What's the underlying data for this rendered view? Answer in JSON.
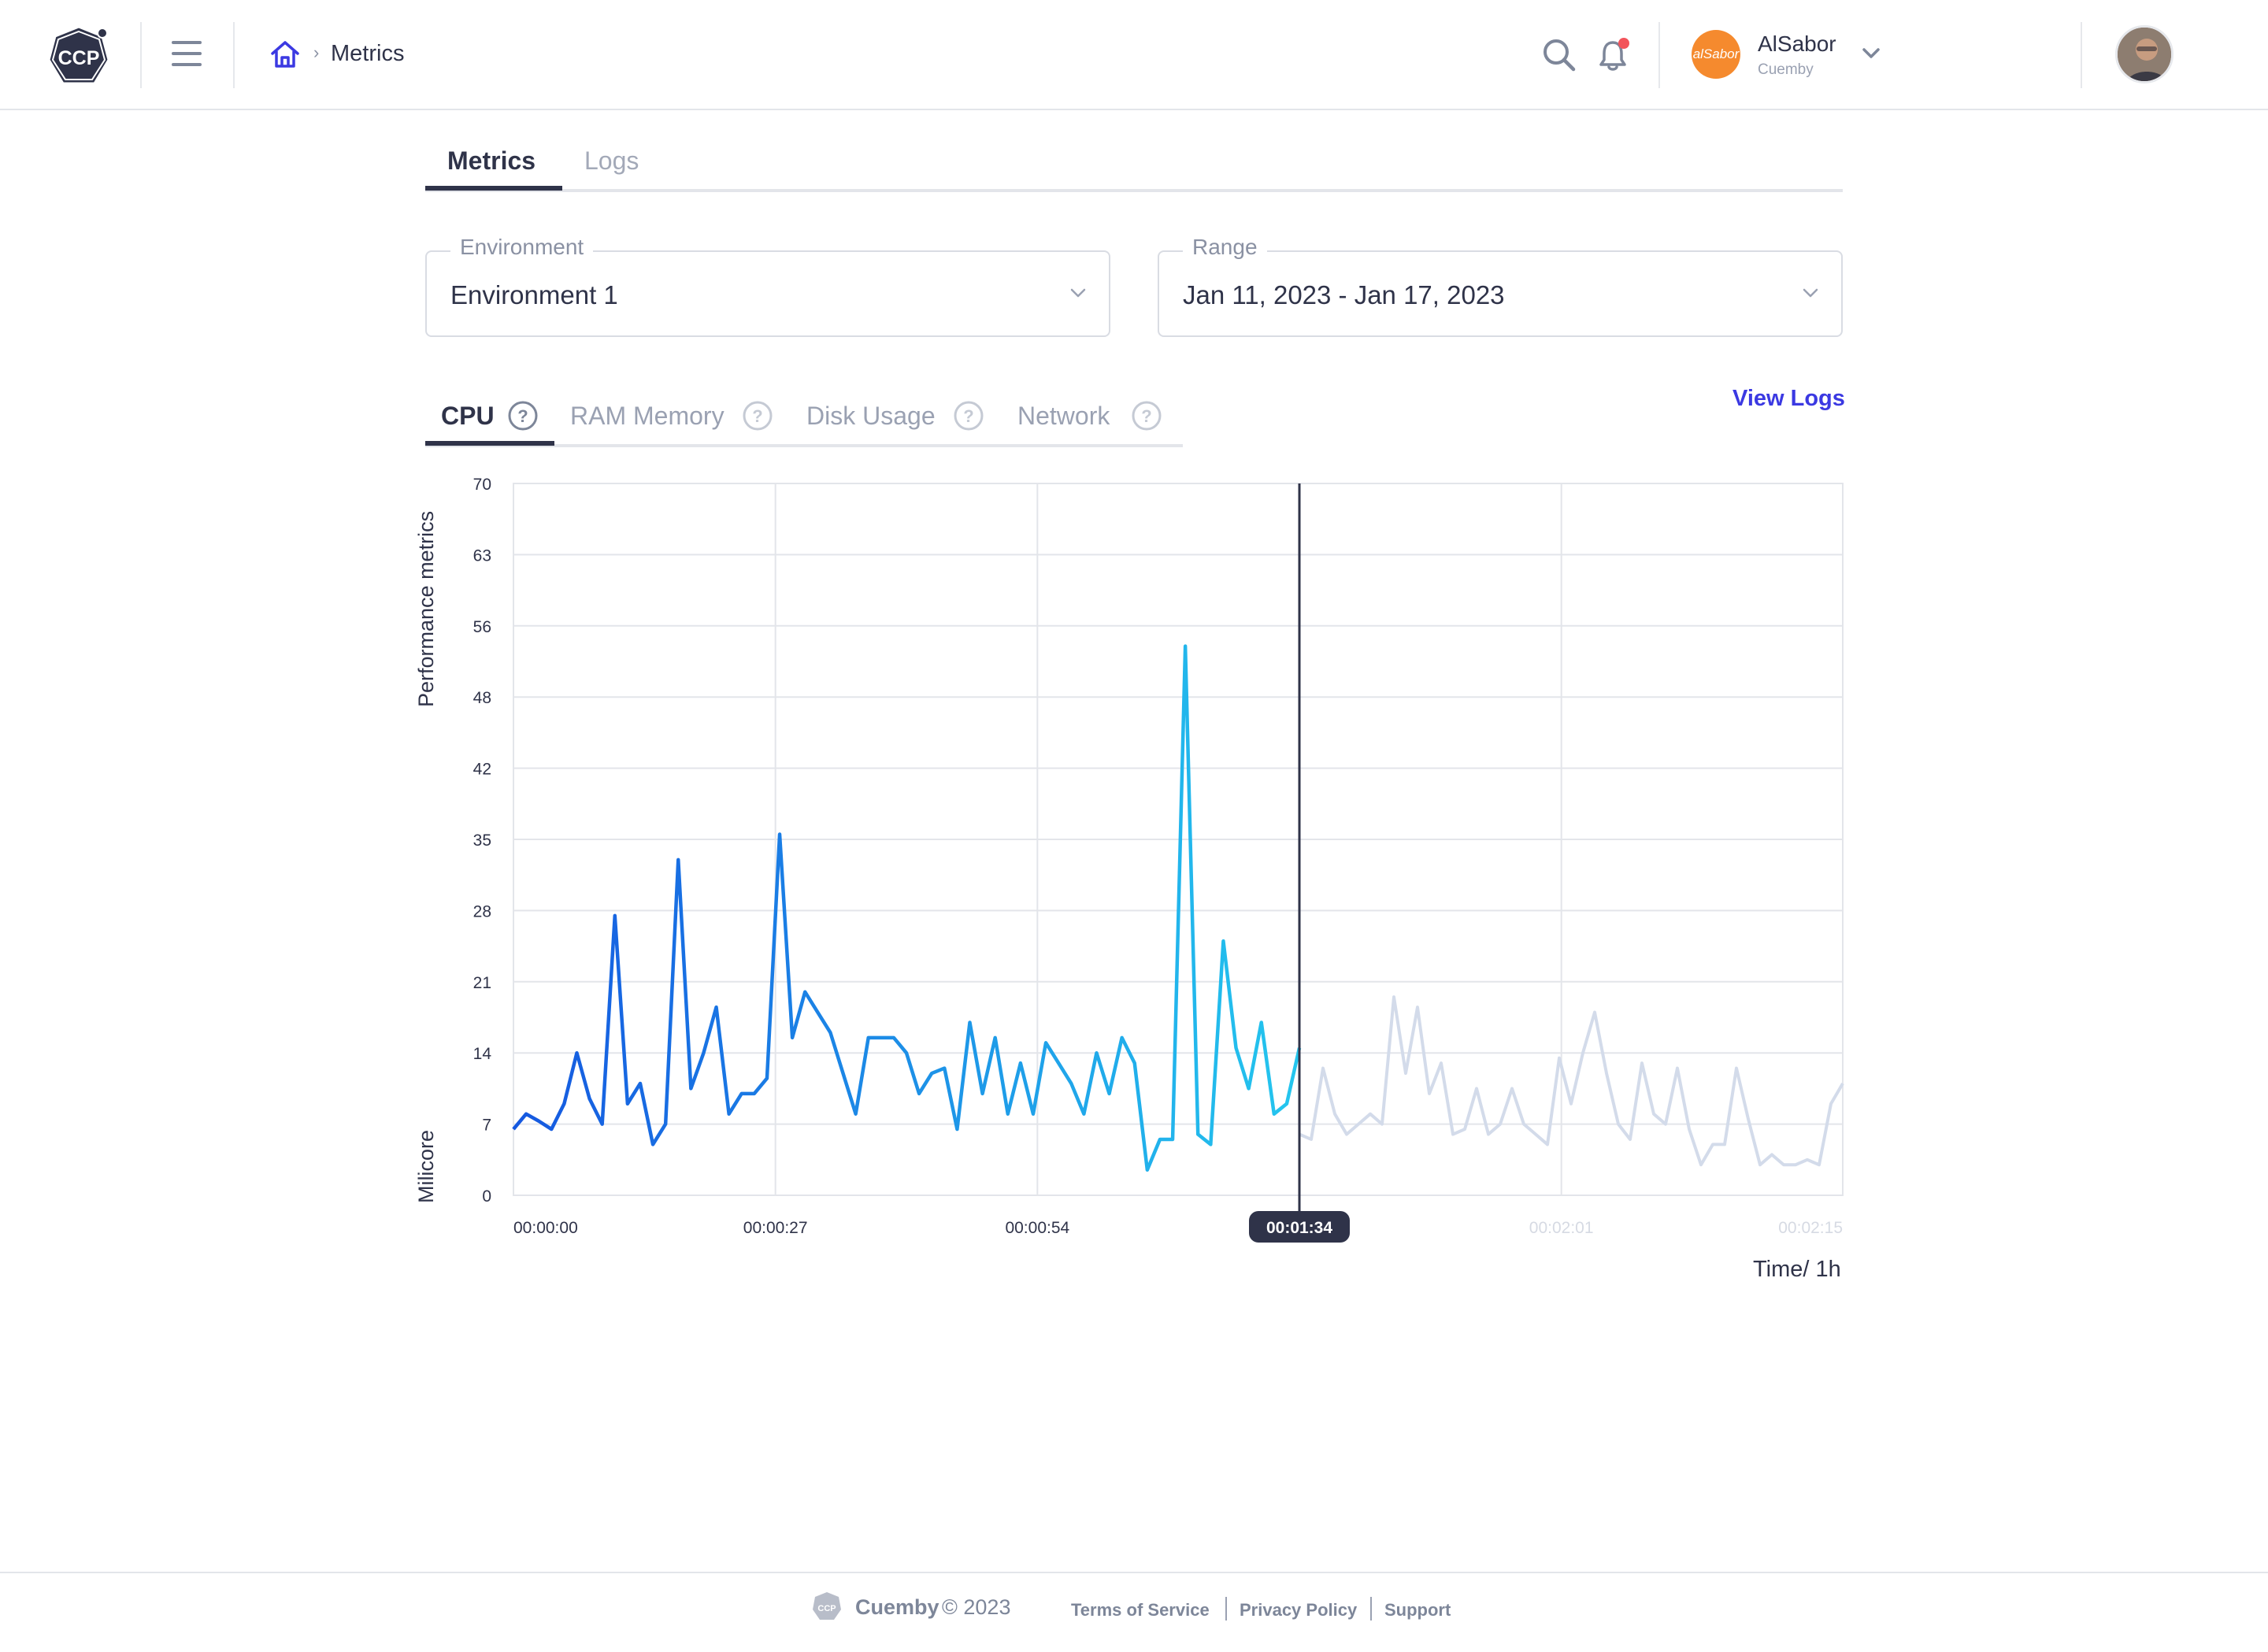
{
  "header": {
    "logo_text": "CCP",
    "breadcrumb_current": "Metrics",
    "org_name": "AlSabor",
    "org_logo_text": "alSabor",
    "org_sub": "Cuemby"
  },
  "page_tabs": [
    {
      "label": "Metrics",
      "active": true
    },
    {
      "label": "Logs",
      "active": false
    }
  ],
  "filters": {
    "environment": {
      "label": "Environment",
      "value": "Environment 1"
    },
    "range": {
      "label": "Range",
      "value": "Jan 11, 2023 - Jan 17, 2023"
    }
  },
  "metric_tabs": [
    {
      "label": "CPU",
      "active": true
    },
    {
      "label": "RAM Memory",
      "active": false
    },
    {
      "label": "Disk Usage",
      "active": false
    },
    {
      "label": "Network",
      "active": false
    }
  ],
  "view_logs_label": "View Logs",
  "colors": {
    "accent": "#3b39e2",
    "line_start": "#1558e0",
    "line_end": "#24c6ee",
    "line_future": "#d3dbea",
    "cursor": "#2f3349",
    "notify": "#f2545b"
  },
  "chart_data": {
    "type": "line",
    "ylabel_top": "Performance metrics",
    "ylabel_bottom": "Milicore",
    "xlabel": "Time/ 1h",
    "y_ticks": [
      "70",
      "63",
      "56",
      "48",
      "42",
      "35",
      "28",
      "21",
      "14",
      "7",
      "0"
    ],
    "ylim": [
      0,
      70
    ],
    "x_tick_labels": [
      "00:00:00",
      "00:00:27",
      "00:00:54",
      "00:01:34",
      "00:02:01",
      "00:02:15"
    ],
    "x_tick_positions": [
      0,
      27,
      54,
      81,
      108,
      137
    ],
    "xlim": [
      0,
      137
    ],
    "cursor_x": 81,
    "cursor_label": "00:01:34",
    "grid": true,
    "series": [
      {
        "values": [
          6.5,
          8,
          7.3,
          6.5,
          9,
          14,
          9.5,
          7,
          27.5,
          9,
          11,
          5,
          7,
          33,
          10.5,
          14,
          18.5,
          8,
          10,
          10,
          11.5,
          35.5,
          15.5,
          20,
          18,
          16,
          12,
          8,
          15.5,
          15.5,
          15.5,
          14,
          10,
          12,
          12.5,
          6.5,
          17,
          10,
          15.5,
          8,
          13,
          8,
          15,
          13,
          11,
          8,
          14,
          10,
          15.5,
          13,
          2.5,
          5.5,
          5.5,
          54,
          6,
          5,
          25,
          14.5,
          10.5,
          17,
          8,
          9,
          14.5
        ]
      },
      {
        "values": [
          6,
          5.5,
          12.5,
          8,
          6,
          7,
          8,
          7,
          19.5,
          12,
          18.5,
          10,
          13,
          6,
          6.5,
          10.5,
          6,
          7,
          10.5,
          7,
          6,
          5,
          13.5,
          9,
          14,
          18,
          12,
          7,
          5.5,
          13,
          8,
          7,
          12.5,
          6.5,
          3,
          5,
          5,
          12.5,
          7.5,
          3,
          4,
          3,
          3,
          3.5,
          3,
          9,
          11
        ]
      }
    ]
  },
  "footer": {
    "brand": "Cuemby",
    "copyright": "© 2023",
    "links": [
      "Terms of Service",
      "Privacy Policy",
      "Support"
    ]
  }
}
